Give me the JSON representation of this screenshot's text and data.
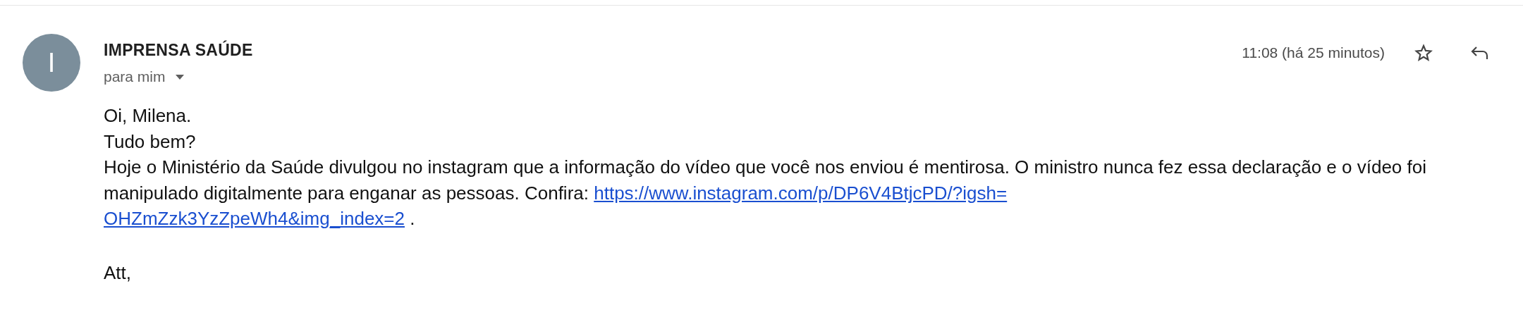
{
  "message": {
    "sender_initial": "I",
    "sender": "IMPRENSA SAÚDE",
    "recipient": "para mim",
    "time": "11:08 (há 25 minutos)",
    "starred": false
  },
  "body": [
    {
      "kind": "line",
      "text": "Oi, Milena."
    },
    {
      "kind": "line",
      "text": "Tudo bem?"
    },
    {
      "kind": "paragraph",
      "text": "Hoje o Ministério da Saúde divulgou no instagram que a informação do vídeo que você nos enviou é mentirosa. O ministro nunca fez essa declaração e o vídeo foi manipulado digitalmente para enganar as pessoas. Confira:",
      "link_lines": [
        "https://www.instagram.com/p/DP6V4BtjcPD/?igsh=",
        "OHZmZzk3YzZpeWh4&img_index=2"
      ],
      "after": "."
    },
    {
      "kind": "blank"
    },
    {
      "kind": "line",
      "text": "Att,"
    }
  ]
}
